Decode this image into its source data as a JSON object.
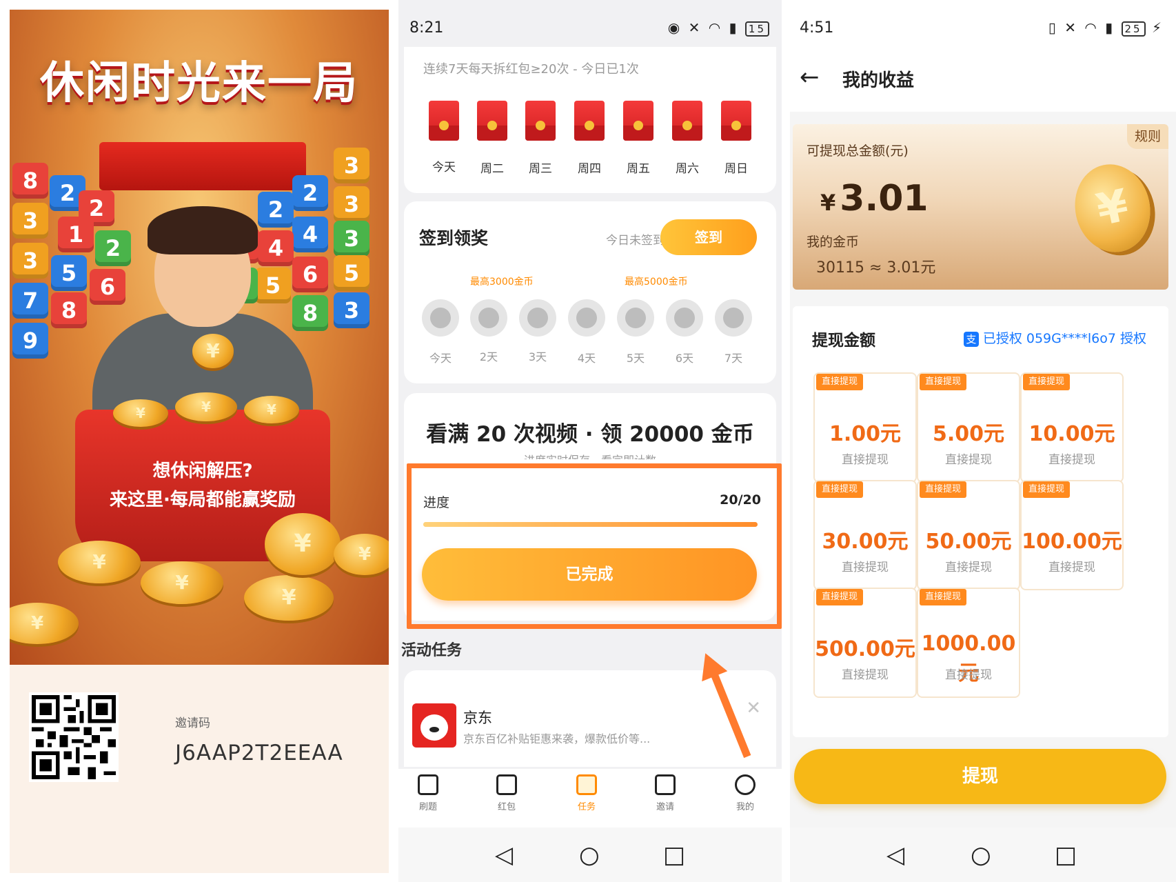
{
  "poster": {
    "title": "休闲时光来一局",
    "pot_line1": "想休闲解压?",
    "pot_line2": "来这里·每局都能赢奖励",
    "invite_label": "邀请码",
    "invite_code": "J6AAP2T2EEAA"
  },
  "tasks_screen": {
    "status_bar": {
      "time": "8:21",
      "battery": "15"
    },
    "streak": {
      "title": "连续7天每天拆红包≥20次 - 今日已1次",
      "days": [
        "今天",
        "周二",
        "周三",
        "周四",
        "周五",
        "周六",
        "周日"
      ]
    },
    "signin": {
      "title": "签到领奖",
      "status": "今日未签到",
      "button": "签到",
      "reward_tags": [
        "最高3000金币",
        "最高5000金币"
      ],
      "days": [
        "今天",
        "2天",
        "3天",
        "4天",
        "5天",
        "6天",
        "7天"
      ]
    },
    "video_task": {
      "title": "看满 20 次视频 · 领 20000 金币",
      "subtitle": "进度实时保存，看完即计数",
      "progress_label": "进度",
      "progress_count": "20/20",
      "progress_fraction": 1.0,
      "button": "已完成"
    },
    "activity": {
      "title": "活动任务",
      "item_name": "京东",
      "item_desc": "京东百亿补贴钜惠来袭，爆款低价等..."
    },
    "tabs": [
      {
        "label": "刷题"
      },
      {
        "label": "红包"
      },
      {
        "label": "任务"
      },
      {
        "label": "邀请"
      },
      {
        "label": "我的"
      }
    ],
    "active_tab": "任务",
    "highlight_color": "#ff7a2d"
  },
  "earnings_screen": {
    "status_bar": {
      "time": "4:51",
      "battery": "25"
    },
    "title": "我的收益",
    "rules": "规则",
    "withdrawable_label": "可提现总金额(元)",
    "currency_symbol": "¥",
    "amount": "3.01",
    "coins_label": "我的金币",
    "coins_value": "30115 ≈ 3.01元",
    "withdraw_title": "提现金额",
    "auth_text": "已授权 059G****l6o7 授权",
    "options": [
      {
        "badge": "直接提现",
        "amount": "1.00元",
        "sub": "直接提现"
      },
      {
        "badge": "直接提现",
        "amount": "5.00元",
        "sub": "直接提现"
      },
      {
        "badge": "直接提现",
        "amount": "10.00元",
        "sub": "直接提现"
      },
      {
        "badge": "直接提现",
        "amount": "30.00元",
        "sub": "直接提现"
      },
      {
        "badge": "直接提现",
        "amount": "50.00元",
        "sub": "直接提现"
      },
      {
        "badge": "直接提现",
        "amount": "100.00元",
        "sub": "直接提现"
      },
      {
        "badge": "直接提现",
        "amount": "500.00元",
        "sub": "直接提现"
      },
      {
        "badge": "直接提现",
        "amount": "1000.00元",
        "sub": "直接提现"
      }
    ],
    "withdraw_button": "提现"
  }
}
